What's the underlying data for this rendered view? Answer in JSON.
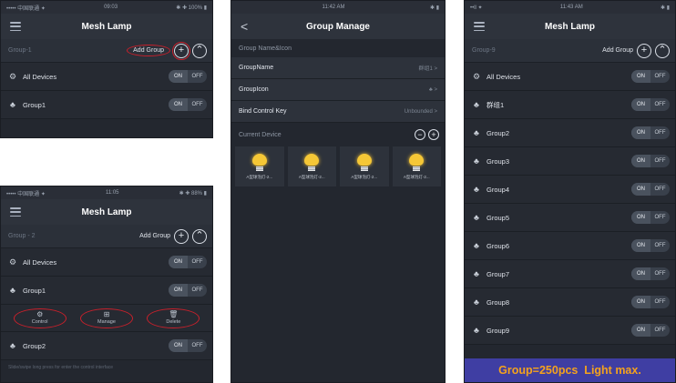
{
  "status": {
    "a": {
      "left": "••••• 中国联通 ✦",
      "center": "09:03",
      "right": "✱ ✚ 100% ▮"
    },
    "b": {
      "left": "••••• 中国联通 ✦",
      "center": "11:05",
      "right": "✱ ✚ 88% ▮"
    },
    "c": {
      "left": "",
      "center": "11:42 AM",
      "right": "✱ ▮"
    },
    "d": {
      "left": "••ll ✦",
      "center": "11:43 AM",
      "right": "✱ ▮"
    }
  },
  "app_title": "Mesh Lamp",
  "add_group": "Add Group",
  "on_label": "ON",
  "off_label": "OFF",
  "plus_glyph": "+",
  "minus_glyph": "−",
  "up_glyph": "⌃",
  "panelA": {
    "group_label": "Group-1",
    "rows": [
      {
        "icon": "⚙",
        "name": "All Devices"
      },
      {
        "icon": "♣",
        "name": "Group1"
      }
    ]
  },
  "panelB": {
    "group_label": "Group - 2",
    "rows": [
      {
        "icon": "⚙",
        "name": "All Devices"
      },
      {
        "icon": "♣",
        "name": "Group1"
      }
    ],
    "actions": [
      {
        "icon": "⚙",
        "label": "Control"
      },
      {
        "icon": "⊞",
        "label": "Manage"
      },
      {
        "icon": "🗑",
        "label": "Delete"
      }
    ],
    "last_row": {
      "icon": "♣",
      "name": "Group2"
    },
    "footnote": "Slide/swipe long press for enter the control interface"
  },
  "panelC": {
    "back_glyph": "<",
    "title": "Group Manage",
    "section": "Group Name&Icon",
    "rows": [
      {
        "key": "GroupName",
        "value": "群组1 >"
      },
      {
        "key": "GroupIcon",
        "value": "♣ >"
      },
      {
        "key": "Bind Control Key",
        "value": "Unbounded >"
      }
    ],
    "current_device": "Current Device",
    "bulbs": [
      "A型球泡灯-2...",
      "A型球泡灯-2...",
      "A型球泡灯-2...",
      "A型球泡灯-2..."
    ]
  },
  "panelD": {
    "group_label": "Group-9",
    "rows": [
      {
        "icon": "⚙",
        "name": "All Devices"
      },
      {
        "icon": "♣",
        "name": "群组1"
      },
      {
        "icon": "♣",
        "name": "Group2"
      },
      {
        "icon": "♣",
        "name": "Group3"
      },
      {
        "icon": "♣",
        "name": "Group4"
      },
      {
        "icon": "♣",
        "name": "Group5"
      },
      {
        "icon": "♣",
        "name": "Group6"
      },
      {
        "icon": "♣",
        "name": "Group7"
      },
      {
        "icon": "♣",
        "name": "Group8"
      },
      {
        "icon": "♣",
        "name": "Group9"
      }
    ],
    "banner": "Group=250pcs  Light max."
  },
  "colors": {
    "banner_bg": "#3f3ea3",
    "banner_text": "#f4a21d",
    "highlight_ring": "#c8202b"
  }
}
